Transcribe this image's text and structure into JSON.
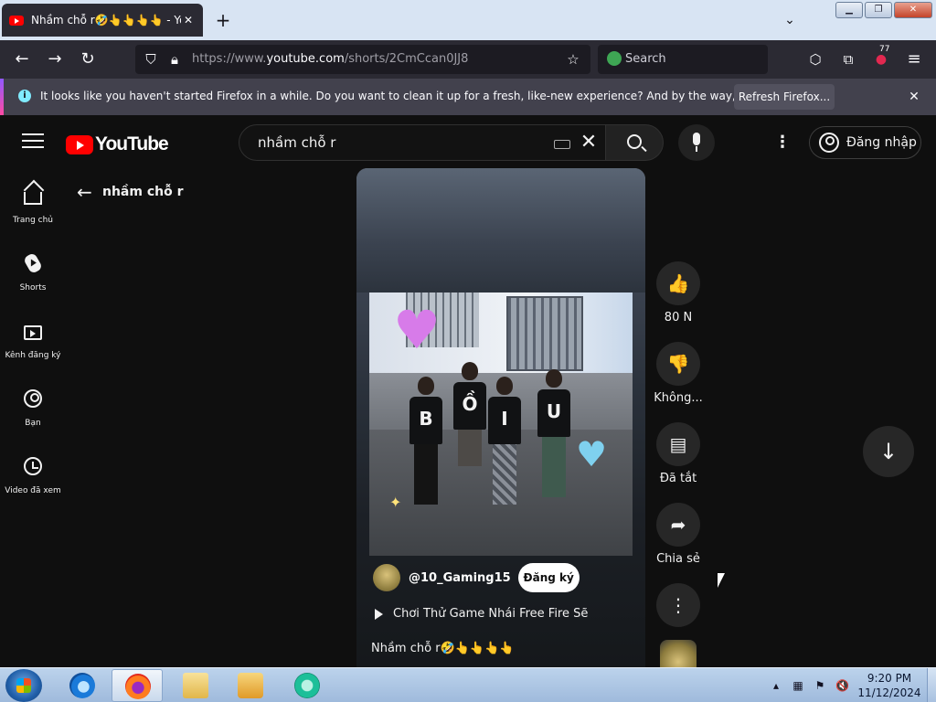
{
  "browser": {
    "tab_title": "Nhầm chỗ r🤣👆👆👆👆 - YouTube",
    "tab_close": "✕",
    "new_tab": "+",
    "tab_list": "⌄",
    "win_minimize": "▁",
    "win_restore": "❐",
    "win_close": "✕",
    "url_prefix": "https://www.",
    "url_domain": "youtube.com",
    "url_path": "/shorts/2CmCcan0JJ8",
    "search_placeholder": "Search",
    "extension_badge": "77",
    "icons": [
      "back-icon",
      "forward-icon",
      "reload-icon",
      "shield-icon",
      "lock-icon",
      "star-icon",
      "pocket-icon",
      "extensions-icon",
      "addon-icon",
      "menu-icon"
    ]
  },
  "notice": {
    "text": "It looks like you haven't started Firefox in a while. Do you want to clean it up for a fresh, like-new experience? And by the way, welcome back!",
    "button": "Refresh Firefox...",
    "close": "✕"
  },
  "youtube": {
    "logo_text": "YouTube",
    "search_query": "nhầm chỗ r",
    "clear": "✕",
    "more": "⋮",
    "signin": "Đăng nhập",
    "guide": [
      {
        "label": "Trang chủ",
        "icon": "home-icon"
      },
      {
        "label": "Shorts",
        "icon": "shorts-icon"
      },
      {
        "label": "Kênh đăng ký",
        "icon": "subscriptions-icon"
      },
      {
        "label": "Bạn",
        "icon": "you-icon"
      },
      {
        "label": "Video đã xem",
        "icon": "history-icon"
      }
    ],
    "back_arrow": "←",
    "back_title": "nhầm chỗ r"
  },
  "short": {
    "shirt_letters": [
      "B",
      "Ồ",
      "I",
      "U"
    ],
    "heart": "♥",
    "sparkle": "✦",
    "channel": "@10_Gaming15",
    "subscribe": "Đăng ký",
    "playlist": "Chơi Thử Game Nhái Free Fire Sẽ",
    "title": "Nhầm chỗ r🤣👆👆👆👆",
    "actions": {
      "like_glyph": "👍",
      "like_count": "80 N",
      "dislike_glyph": "👎",
      "dislike_label": "Không...",
      "comments_glyph": "▤",
      "comments_label": "Đã tắt",
      "share_glyph": "➦",
      "share_label": "Chia sẻ",
      "more_glyph": "⋮"
    },
    "next_glyph": "↓"
  },
  "taskbar": {
    "apps": [
      "internet-explorer",
      "firefox",
      "file-explorer",
      "media-player",
      "app"
    ],
    "tray": {
      "show_hidden": "▴",
      "network": "▦",
      "flag": "⚑",
      "volume": "🔇"
    },
    "time": "9:20 PM",
    "date": "11/12/2024"
  }
}
